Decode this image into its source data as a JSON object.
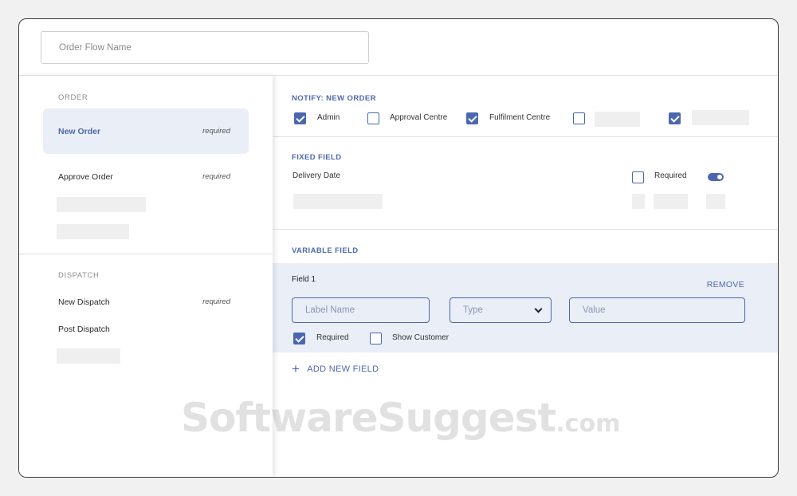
{
  "flow_name": {
    "placeholder": "Order Flow Name"
  },
  "sidebar": {
    "order_title": "ORDER",
    "order_items": [
      {
        "label": "New Order",
        "tag": "required",
        "active": true
      },
      {
        "label": "Approve Order",
        "tag": "required",
        "active": false
      }
    ],
    "dispatch_title": "DISPATCH",
    "dispatch_items": [
      {
        "label": "New Dispatch",
        "tag": "required"
      },
      {
        "label": "Post Dispatch",
        "tag": ""
      }
    ]
  },
  "notify": {
    "title": "NOTIFY: NEW ORDER",
    "options": [
      {
        "label": "Admin",
        "checked": true
      },
      {
        "label": "Approval Centre",
        "checked": false
      },
      {
        "label": "Fulfilment Centre",
        "checked": true
      },
      {
        "label": "",
        "checked": false
      },
      {
        "label": "",
        "checked": true
      }
    ]
  },
  "fixed_field": {
    "title": "FIXED FIELD",
    "name": "Delivery Date",
    "required_label": "Required",
    "required_checked": false,
    "toggle_on": true
  },
  "variable_field": {
    "title": "VARIABLE FIELD",
    "field_label": "Field 1",
    "remove_label": "REMOVE",
    "label_placeholder": "Label Name",
    "type_placeholder": "Type",
    "value_placeholder": "Value",
    "required_label": "Required",
    "required_checked": true,
    "show_customer_label": "Show Customer",
    "show_customer_checked": false,
    "add_label": "ADD NEW FIELD"
  },
  "watermark": {
    "main": "SoftwareSuggest",
    "suffix": ".com"
  },
  "colors": {
    "accent": "#4a67b0",
    "active_bg": "#e9eef7",
    "placeholder_block": "#efefef"
  }
}
